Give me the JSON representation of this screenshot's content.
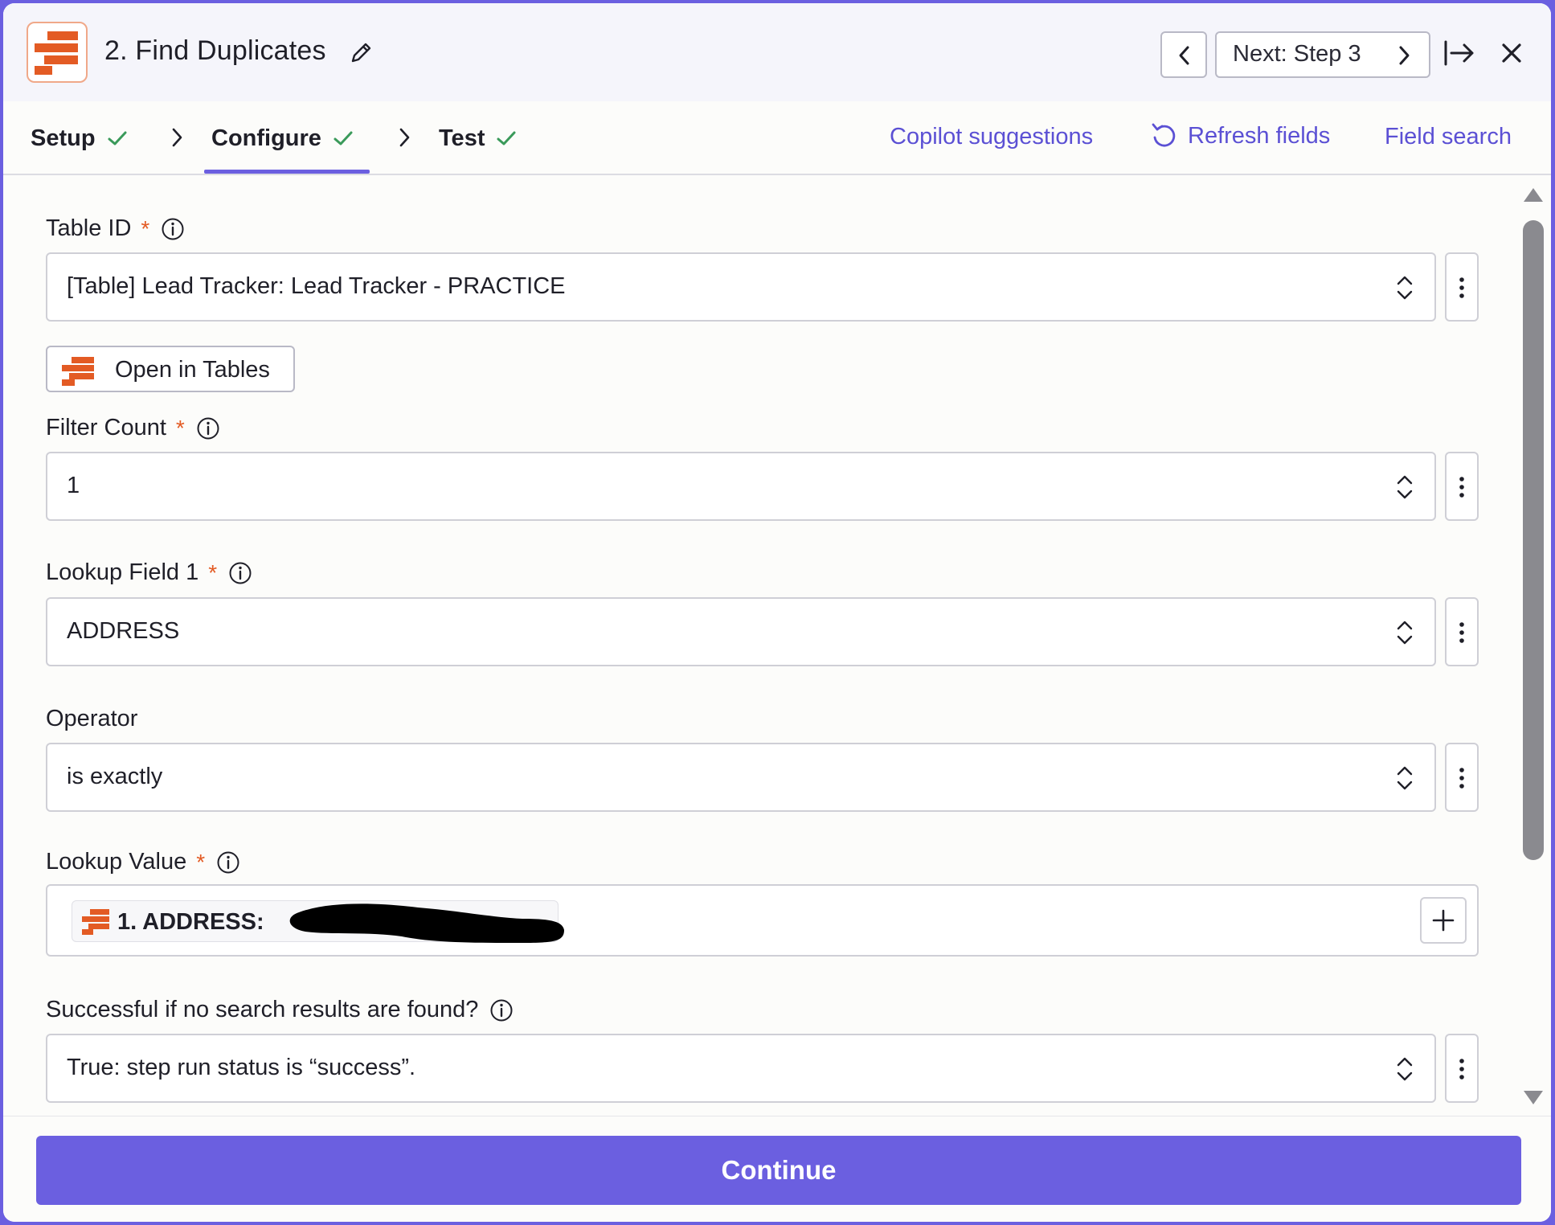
{
  "header": {
    "step_title": "2. Find Duplicates",
    "next_label": "Next: Step 3"
  },
  "tabs": [
    {
      "label": "Setup",
      "complete": true
    },
    {
      "label": "Configure",
      "complete": true,
      "active": true
    },
    {
      "label": "Test",
      "complete": true
    }
  ],
  "actions": {
    "copilot": "Copilot suggestions",
    "refresh": "Refresh fields",
    "field_search": "Field search"
  },
  "fields": {
    "table_id": {
      "label": "Table ID",
      "required": "*",
      "value": "[Table] Lead Tracker: Lead Tracker - PRACTICE"
    },
    "open_in_tables": "Open in Tables",
    "filter_count": {
      "label": "Filter Count",
      "required": "*",
      "value": "1"
    },
    "lookup_field_1": {
      "label": "Lookup Field 1",
      "required": "*",
      "value": "ADDRESS"
    },
    "operator": {
      "label": "Operator",
      "value": "is exactly"
    },
    "lookup_value": {
      "label": "Lookup Value",
      "required": "*",
      "pill_label": "1. ADDRESS:"
    },
    "success_if_none": {
      "label": "Successful if no search results are found?",
      "value": "True: step run status is “success”."
    }
  },
  "footer": {
    "continue_label": "Continue"
  },
  "colors": {
    "accent": "#6b5fe0",
    "brand": "#e35b24",
    "check": "#3a9a5a"
  }
}
